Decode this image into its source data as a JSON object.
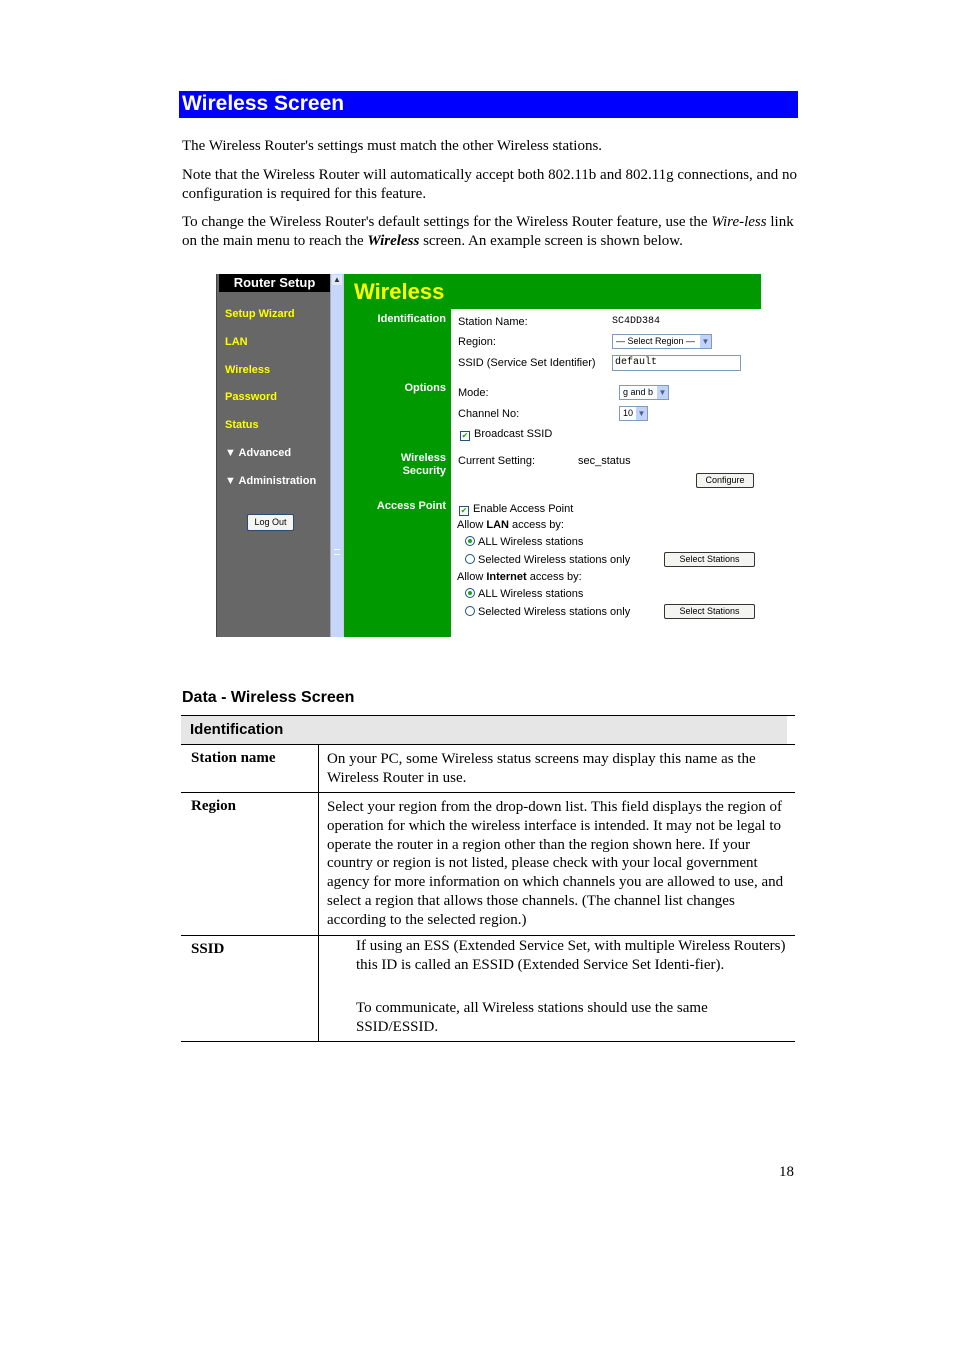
{
  "heading": "Wireless Screen",
  "intro": [
    "The Wireless Router's settings must match the other Wireless stations.",
    "Note that the Wireless Router will automatically accept both 802.11b and 802.11g connections, and no configuration is required for this feature."
  ],
  "intro3": {
    "before": "To change the Wireless Router's default settings for the Wireless Router feature, use the ",
    "link_italic": "Wire-less",
    "middle": " link on the main menu to reach the ",
    "screen_name": "Wireless",
    "after": " screen. An example screen is shown below."
  },
  "screenshot": {
    "sidebar": {
      "title": "Router Setup",
      "items": [
        "Setup Wizard",
        "LAN",
        "Wireless",
        "Password",
        "Status"
      ],
      "expandable": [
        "Advanced",
        "Administration"
      ],
      "logout_label": "Log Out"
    },
    "page_title": "Wireless",
    "sections": {
      "identification": "Identification",
      "options": "Options",
      "wireless_security_1": "Wireless",
      "wireless_security_2": "Security",
      "access_point": "Access Point"
    },
    "fields": {
      "station_name_label": "Station Name:",
      "station_name_value": "SC4DD384",
      "region_label": "Region:",
      "region_value": "— Select Region —",
      "ssid_label": "SSID (Service Set Identifier)",
      "ssid_value": "default",
      "mode_label": "Mode:",
      "mode_value": "g and b",
      "channel_label": "Channel No:",
      "channel_value": "10",
      "broadcast_ssid_label": "Broadcast SSID",
      "broadcast_ssid_checked": true,
      "current_setting_label": "Current Setting:",
      "current_setting_value": "sec_status",
      "configure_label": "Configure",
      "enable_ap_label": "Enable Access Point",
      "enable_ap_checked": true,
      "allow_lan_pre": "Allow ",
      "allow_lan_bold": "LAN",
      "allow_lan_post": " access by:",
      "lan_all": "ALL Wireless stations",
      "lan_selected": "Selected Wireless stations only",
      "allow_inet_pre": "Allow ",
      "allow_inet_bold": "Internet",
      "allow_inet_post": " access by:",
      "inet_all": "ALL Wireless stations",
      "inet_selected": "Selected Wireless stations only",
      "select_stations_label": "Select Stations"
    }
  },
  "data_heading": "Data - Wireless Screen",
  "table": {
    "section": "Identification",
    "rows": [
      {
        "label": "Station name",
        "desc": [
          "On your PC, some Wireless status screens may display this name as the Wireless Router in use."
        ]
      },
      {
        "label": "Region",
        "desc": [
          "Select your region from the drop-down list. This field displays the region of operation for which the wireless interface is intended. It may not be legal to operate the router in a region other than the region shown here. If your country or region is not listed, please check with your local government agency for more information on which channels you are allowed to use, and select a region that allows those channels. (The channel list changes according to the selected region.)"
        ]
      },
      {
        "label": "SSID",
        "desc": [
          "If using an ESS (Extended Service Set, with multiple Wireless Routers) this ID is called an ESSID (Extended Service Set Identi-fier).",
          "To communicate, all Wireless stations should use the same SSID/ESSID."
        ]
      }
    ]
  },
  "page_number": "18"
}
